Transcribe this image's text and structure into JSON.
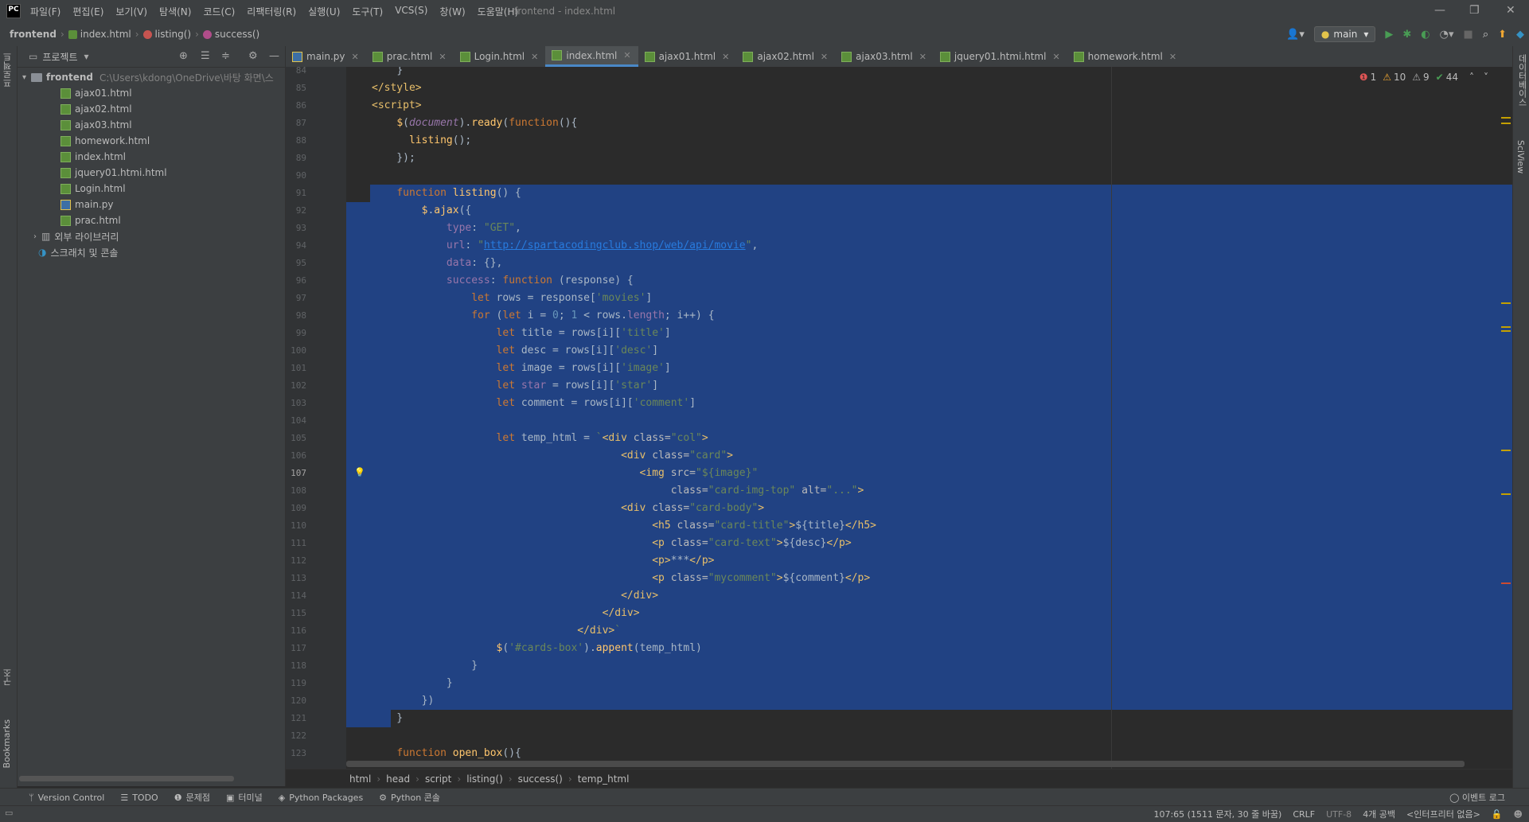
{
  "app": {
    "logo_text": "PC",
    "window_title": "frontend - index.html",
    "win_minimize": "—",
    "win_restore": "❐",
    "win_close": "✕"
  },
  "menu": [
    "파일(F)",
    "편집(E)",
    "보기(V)",
    "탐색(N)",
    "코드(C)",
    "리팩터링(R)",
    "실행(U)",
    "도구(T)",
    "VCS(S)",
    "창(W)",
    "도움말(H)"
  ],
  "nav": {
    "project": "frontend",
    "file": "index.html",
    "func": "listing()",
    "method": "success()",
    "run_config": "main"
  },
  "left_strip": {
    "project_tab": "프로젝트",
    "structure_tab": "구조",
    "bookmarks_tab": "Bookmarks"
  },
  "right_strip": {
    "db_tab": "데이터베이스",
    "sciview_tab": "SciView"
  },
  "project_panel": {
    "title": "프로젝트",
    "root_name": "frontend",
    "root_path": "C:\\Users\\kdong\\OneDrive\\바탕 화면\\스",
    "files": [
      "ajax01.html",
      "ajax02.html",
      "ajax03.html",
      "homework.html",
      "index.html",
      "jquery01.htmi.html",
      "Login.html",
      "main.py",
      "prac.html"
    ],
    "external_libs": "외부 라이브러리",
    "scratches": "스크래치 및 콘솔"
  },
  "tabs": [
    {
      "label": "main.py",
      "type": "py"
    },
    {
      "label": "prac.html",
      "type": "html"
    },
    {
      "label": "Login.html",
      "type": "html"
    },
    {
      "label": "index.html",
      "type": "html",
      "active": true
    },
    {
      "label": "ajax01.html",
      "type": "html"
    },
    {
      "label": "ajax02.html",
      "type": "html"
    },
    {
      "label": "ajax03.html",
      "type": "html"
    },
    {
      "label": "jquery01.htmi.html",
      "type": "html"
    },
    {
      "label": "homework.html",
      "type": "html"
    }
  ],
  "inspections": {
    "errors": "1",
    "warnings": "10",
    "weak": "9",
    "ok": "44"
  },
  "editor": {
    "current_line": 107,
    "lines": [
      {
        "n": 84,
        "h": "    <span>}</span>"
      },
      {
        "n": 85,
        "h": "<span class=\"tag\">&lt;/style&gt;</span>"
      },
      {
        "n": 86,
        "h": "<span class=\"tag\">&lt;script&gt;</span>"
      },
      {
        "n": 87,
        "h": "    <span class=\"fn\">$</span>(<span class=\"ital\">document</span>).<span class=\"fn\">ready</span>(<span class=\"kw\">function</span>(){"
      },
      {
        "n": 88,
        "h": "      <span class=\"fn\">listing</span>();"
      },
      {
        "n": 89,
        "h": "    });"
      },
      {
        "n": 90,
        "h": ""
      },
      {
        "n": 91,
        "h": "    <span class=\"kw\">function</span> <span class=\"fn\">listing</span>() {"
      },
      {
        "n": 92,
        "h": "        <span class=\"fn\">$</span>.<span class=\"fn\">ajax</span>({"
      },
      {
        "n": 93,
        "h": "            <span class=\"prop\">type</span>: <span class=\"str\">\"GET\"</span>,"
      },
      {
        "n": 94,
        "h": "            <span class=\"prop\">url</span>: <span class=\"str\">\"<span class=\"link\">http://spartacodingclub.shop/web/api/movie</span>\"</span>,"
      },
      {
        "n": 95,
        "h": "            <span class=\"prop\">data</span>: {},"
      },
      {
        "n": 96,
        "h": "            <span class=\"prop\">success</span>: <span class=\"kw\">function</span> (response) {"
      },
      {
        "n": 97,
        "h": "                <span class=\"kw\">let</span> rows = response[<span class=\"str\">'movies'</span>]"
      },
      {
        "n": 98,
        "h": "                <span class=\"kw\">for</span> (<span class=\"kw\">let</span> i = <span class=\"num\">0</span>; <span class=\"num\">1</span> &lt; rows.<span class=\"prop\">length</span>; i++) {"
      },
      {
        "n": 99,
        "h": "                    <span class=\"kw\">let</span> title = rows[i][<span class=\"str\">'title'</span>]"
      },
      {
        "n": 100,
        "h": "                    <span class=\"kw\">let</span> desc = rows[i][<span class=\"str\">'desc'</span>]"
      },
      {
        "n": 101,
        "h": "                    <span class=\"kw\">let</span> image = rows[i][<span class=\"str\">'image'</span>]"
      },
      {
        "n": 102,
        "h": "                    <span class=\"kw\">let</span> <span class=\"prop\">star</span> = rows[i][<span class=\"str\">'star'</span>]"
      },
      {
        "n": 103,
        "h": "                    <span class=\"kw\">let</span> comment = rows[i][<span class=\"str\">'comment'</span>]"
      },
      {
        "n": 104,
        "h": ""
      },
      {
        "n": 105,
        "h": "                    <span class=\"kw\">let</span> temp_html = <span class=\"str\">`</span><span class=\"tag\">&lt;div </span><span class=\"attr\">class=</span><span class=\"str\">\"col\"</span><span class=\"tag\">&gt;</span>"
      },
      {
        "n": 106,
        "h": "                                        <span class=\"tag\">&lt;div </span><span class=\"attr\">class=</span><span class=\"str\">\"card\"</span><span class=\"tag\">&gt;</span>"
      },
      {
        "n": 107,
        "h": "                                           <span class=\"tag\">&lt;img </span><span class=\"attr\">src=</span><span class=\"str\">\"${image}\"</span>"
      },
      {
        "n": 108,
        "h": "                                                <span class=\"attr\">class=</span><span class=\"str\">\"card-img-top\"</span> <span class=\"attr\">alt=</span><span class=\"str\">\"...\"</span><span class=\"tag\">&gt;</span>"
      },
      {
        "n": 109,
        "h": "                                        <span class=\"tag\">&lt;div </span><span class=\"attr\">class=</span><span class=\"str\">\"card-body\"</span><span class=\"tag\">&gt;</span>"
      },
      {
        "n": 110,
        "h": "                                             <span class=\"tag\">&lt;h5 </span><span class=\"attr\">class=</span><span class=\"str\">\"card-title\"</span><span class=\"tag\">&gt;</span>${title}<span class=\"tag\">&lt;/h5&gt;</span>"
      },
      {
        "n": 111,
        "h": "                                             <span class=\"tag\">&lt;p </span><span class=\"attr\">class=</span><span class=\"str\">\"card-text\"</span><span class=\"tag\">&gt;</span>${desc}<span class=\"tag\">&lt;/p&gt;</span>"
      },
      {
        "n": 112,
        "h": "                                             <span class=\"tag\">&lt;p&gt;</span>***<span class=\"tag\">&lt;/p&gt;</span>"
      },
      {
        "n": 113,
        "h": "                                             <span class=\"tag\">&lt;p </span><span class=\"attr\">class=</span><span class=\"str\">\"mycomment\"</span><span class=\"tag\">&gt;</span>${comment}<span class=\"tag\">&lt;/p&gt;</span>"
      },
      {
        "n": 114,
        "h": "                                        <span class=\"tag\">&lt;/div&gt;</span>"
      },
      {
        "n": 115,
        "h": "                                     <span class=\"tag\">&lt;/div&gt;</span>"
      },
      {
        "n": 116,
        "h": "                                 <span class=\"tag\">&lt;/div&gt;</span><span class=\"str\">`</span>"
      },
      {
        "n": 117,
        "h": "                    <span class=\"fn\">$</span>(<span class=\"str\">'#cards-box'</span>).<span class=\"fn\">appent</span>(temp_html)"
      },
      {
        "n": 118,
        "h": "                }"
      },
      {
        "n": 119,
        "h": "            }"
      },
      {
        "n": 120,
        "h": "        })"
      },
      {
        "n": 121,
        "h": "    }"
      },
      {
        "n": 122,
        "h": ""
      },
      {
        "n": 123,
        "h": "    <span class=\"kw\">function</span> <span class=\"fn\">open_box</span>(){"
      }
    ]
  },
  "code_breadcrumbs": [
    "html",
    "head",
    "script",
    "listing()",
    "success()",
    "temp_html"
  ],
  "tool_windows": [
    {
      "label": "Version Control",
      "icon": "branch-icon"
    },
    {
      "label": "TODO",
      "icon": "list-icon"
    },
    {
      "label": "문제점",
      "icon": "info-icon"
    },
    {
      "label": "터미널",
      "icon": "terminal-icon"
    },
    {
      "label": "Python Packages",
      "icon": "packages-icon"
    },
    {
      "label": "Python 콘솔",
      "icon": "console-icon"
    }
  ],
  "event_log": "이벤트 로그",
  "status": {
    "position": "107:65 (1511 문자, 30 줄 바꿈)",
    "line_sep": "CRLF",
    "encoding": "UTF-8",
    "indent": "4개 공백",
    "interpreter": "<인터프리터 없음>"
  },
  "colors": {
    "selection": "#214283",
    "keyword": "#cc7832",
    "function": "#ffc66d",
    "string": "#6a8759",
    "number": "#6897bb",
    "property": "#9876aa",
    "tag": "#e8bf6a"
  }
}
